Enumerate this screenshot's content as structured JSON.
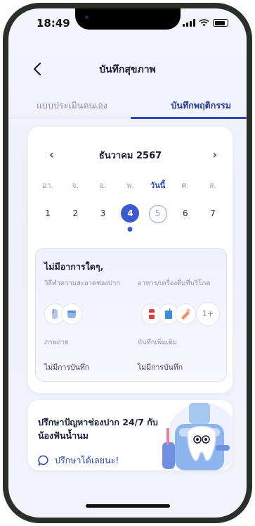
{
  "status_bar": {
    "time": "18:49"
  },
  "header": {
    "title": "บันทึกสุขภาพ"
  },
  "tabs": [
    {
      "label": "แบบประเมินตนเอง",
      "active": false
    },
    {
      "label": "บันทึกพฤติกรรม",
      "active": true
    }
  ],
  "calendar": {
    "month_label": "ธันวาคม 2567",
    "weekdays": [
      "อา.",
      "จ.",
      "อ.",
      "พ.",
      "วันนี้",
      "ศ.",
      "ส."
    ],
    "dates": [
      "1",
      "2",
      "3",
      "4",
      "5",
      "6",
      "7"
    ],
    "selected_date": "4",
    "today_date": "5"
  },
  "summary": {
    "title": "ไม่มีอาการใดๆ,",
    "clean_label": "วิธีทำความสะอาดช่องปาก",
    "food_label": "อาหาร/เครื่องดื่มที่บริโภค",
    "more_count": "1+",
    "photo_label": "ภาพถ่าย",
    "photo_value": "ไม่มีการบันทึก",
    "note_label": "บันทึกเพิ่มเติม",
    "note_value": "ไม่มีการบันทึก"
  },
  "consult": {
    "title": "ปรึกษาปัญหาช่องปาก 24/7 กับน้องฟันน้ำนม",
    "link_label": "ปรึกษาได้เลยนะ!"
  },
  "colors": {
    "accent": "#2b46b8",
    "selected_day": "#3c5ad0",
    "today_ring": "#8fa0e8"
  }
}
